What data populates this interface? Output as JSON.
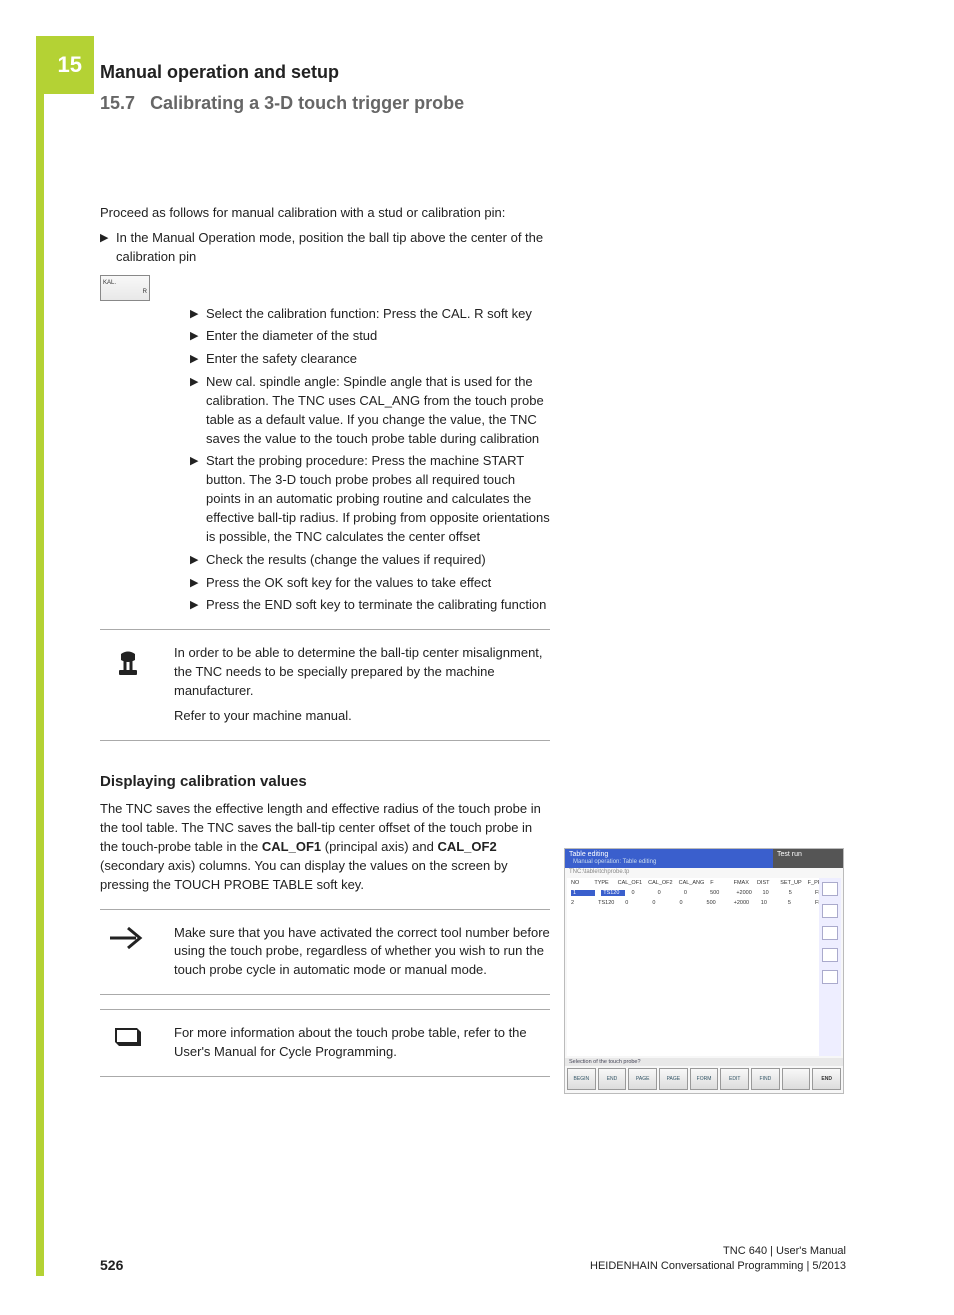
{
  "chapter_number": "15",
  "chapter_title": "Manual operation and setup",
  "section_number": "15.7",
  "section_title": "Calibrating a 3-D touch trigger probe",
  "intro": "Proceed as follows for manual calibration with a stud or calibration pin:",
  "step1": "In the Manual Operation mode, position the ball tip above the center of the calibration pin",
  "softkey_label_top": "KAL.",
  "softkey_label_r": "R",
  "sub_steps": [
    "Select the calibration function: Press the CAL. R soft key",
    "Enter the diameter of the stud",
    "Enter the safety clearance",
    "New cal. spindle angle: Spindle angle that is used for the calibration. The TNC uses CAL_ANG from the touch probe table as a default value. If you change the value, the TNC saves the value to the touch probe table during calibration",
    "Start the probing procedure: Press the machine START button. The 3-D touch probe probes all required touch points in an automatic probing routine and calculates the effective ball-tip radius. If probing from opposite orientations is possible, the TNC calculates the center offset",
    "Check the results (change the values if required)",
    "Press the OK soft key for the values to take effect",
    "Press the END soft key to terminate the calibrating function"
  ],
  "note1_p1": "In order to be able to determine the ball-tip center misalignment, the TNC needs to be specially prepared by the machine manufacturer.",
  "note1_p2": "Refer to your machine manual.",
  "subheading": "Displaying calibration values",
  "display_para_pre": "The TNC saves the effective length and effective radius of the touch probe in the tool table. The TNC saves the ball-tip center offset of the touch probe in the touch-probe table in the ",
  "cal_of1": "CAL_OF1",
  "display_para_mid": " (principal axis) and ",
  "cal_of2": "CAL_OF2",
  "display_para_post": " (secondary axis) columns. You can display the values on the screen by pressing the TOUCH PROBE TABLE soft key.",
  "note2": "Make sure that you have activated the correct tool number before using the touch probe, regardless of whether you wish to run the touch probe cycle in automatic mode or manual mode.",
  "note3": "For more information about the touch probe table, refer to the User's Manual for Cycle Programming.",
  "screenshot": {
    "title_left": "Table editing",
    "subtitle_left": "Manual operation: Table editing",
    "title_right": "Test run",
    "path": "TNC:\\table\\tchprobe.tp",
    "cols": [
      "NO",
      "TYPE",
      "CAL_OF1",
      "CAL_OF2",
      "CAL_ANG",
      "F",
      "FMAX",
      "DIST",
      "SET_UP",
      "F_PREPOS"
    ],
    "row1": [
      "1",
      "TS120",
      "0",
      "0",
      "0",
      "500",
      "+2000",
      "10",
      "5",
      "FMAX_P"
    ],
    "row2": [
      "2",
      "TS120",
      "0",
      "0",
      "0",
      "500",
      "+2000",
      "10",
      "5",
      "FMAX_P"
    ],
    "foot_q": "Selection of the touch probe?",
    "softkeys": [
      "BEGIN",
      "END",
      "PAGE",
      "PAGE",
      "FORM",
      "EDIT",
      "FIND",
      "",
      "END"
    ]
  },
  "page_no": "526",
  "footer_line1": "TNC 640 | User's Manual",
  "footer_line2": "HEIDENHAIN Conversational Programming | 5/2013"
}
